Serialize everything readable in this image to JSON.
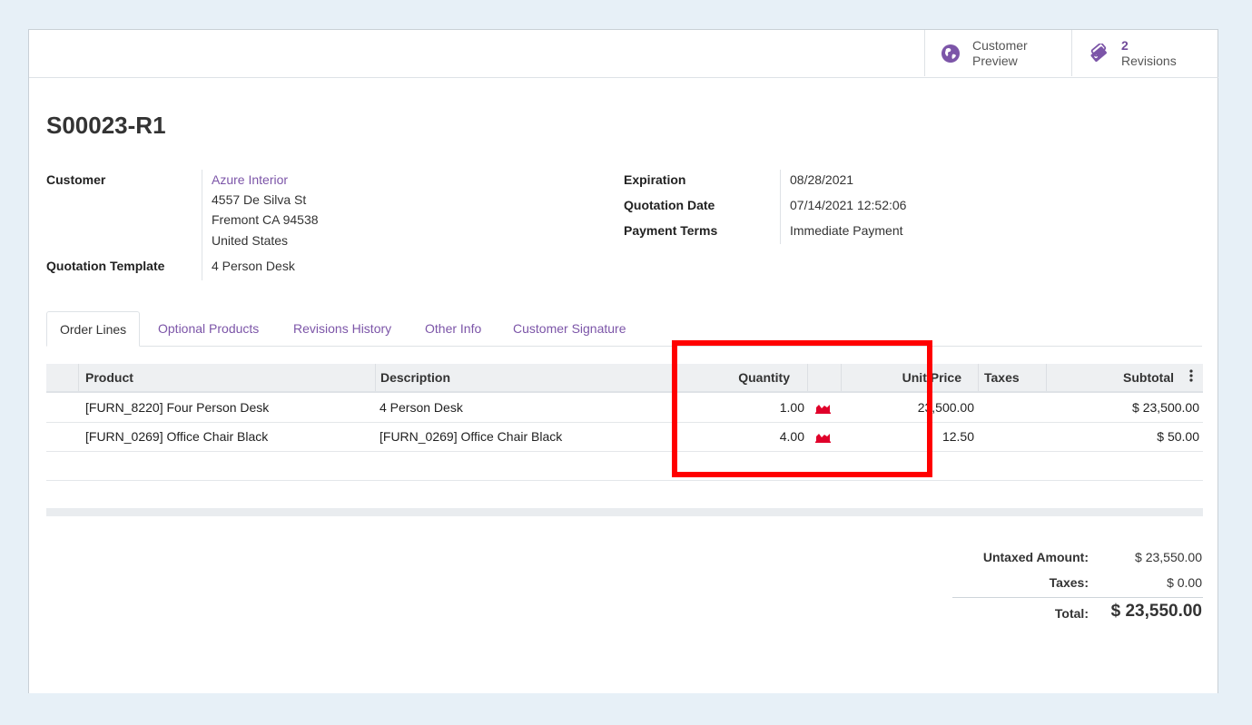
{
  "button_box": {
    "preview_label_1": "Customer",
    "preview_label_2": "Preview",
    "revisions_count": "2",
    "revisions_label": "Revisions"
  },
  "record": {
    "title": "S00023-R1"
  },
  "fields": {
    "customer_label": "Customer",
    "customer_name": "Azure Interior",
    "address_line1": "4557 De Silva St",
    "address_line2": "Fremont CA 94538",
    "address_line3": "United States",
    "template_label": "Quotation Template",
    "template_value": "4 Person Desk",
    "expiration_label": "Expiration",
    "expiration_value": "08/28/2021",
    "quotation_date_label": "Quotation Date",
    "quotation_date_value": "07/14/2021 12:52:06",
    "payment_terms_label": "Payment Terms",
    "payment_terms_value": "Immediate Payment"
  },
  "tabs": [
    "Order Lines",
    "Optional Products",
    "Revisions History",
    "Other Info",
    "Customer Signature"
  ],
  "table": {
    "headers": {
      "product": "Product",
      "description": "Description",
      "quantity": "Quantity",
      "unit_price": "Unit Price",
      "taxes": "Taxes",
      "subtotal": "Subtotal"
    },
    "rows": [
      {
        "product": "[FURN_8220] Four Person Desk",
        "description": "4 Person Desk",
        "quantity": "1.00",
        "unit_price": "23,500.00",
        "taxes": "",
        "subtotal": "$ 23,500.00"
      },
      {
        "product": "[FURN_0269] Office Chair Black",
        "description": "[FURN_0269] Office Chair Black",
        "quantity": "4.00",
        "unit_price": "12.50",
        "taxes": "",
        "subtotal": "$ 50.00"
      }
    ]
  },
  "totals": {
    "untaxed_label": "Untaxed Amount:",
    "untaxed_value": "$ 23,550.00",
    "taxes_label": "Taxes:",
    "taxes_value": "$ 0.00",
    "total_label": "Total:",
    "total_value": "$ 23,550.00"
  },
  "colors": {
    "link": "#7c55a8",
    "highlight": "#ff0000",
    "forecast_icon": "#e0002a"
  },
  "icons": {
    "preview": "globe-icon",
    "revisions": "tag-icon",
    "forecast": "area-chart-icon",
    "column_options": "vertical-ellipsis-icon"
  }
}
